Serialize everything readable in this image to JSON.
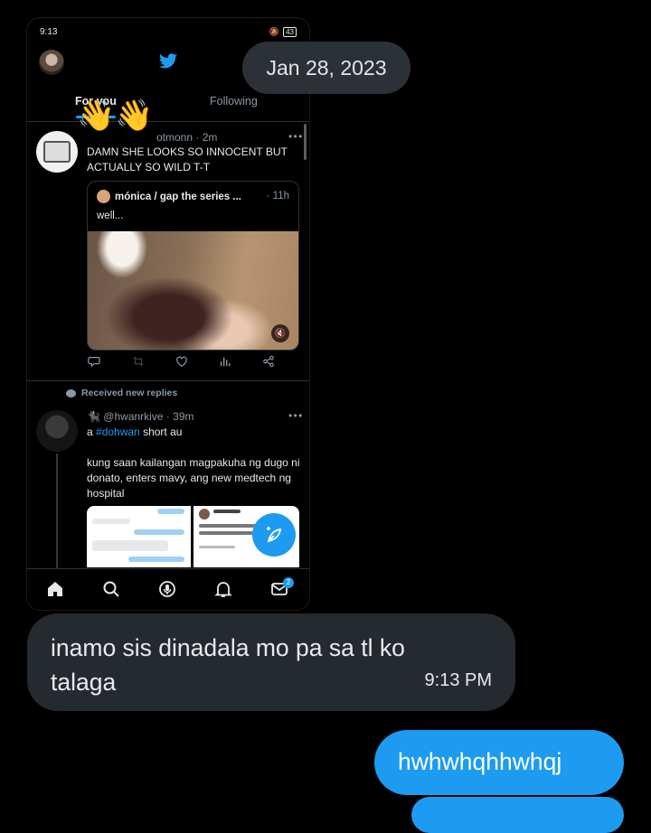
{
  "status_bar": {
    "time": "9:13",
    "signal": ".ıl",
    "battery": "43"
  },
  "tabs": [
    {
      "label": "For you"
    },
    {
      "label": "Following"
    }
  ],
  "wave_emoji": "👋👋",
  "tweet1": {
    "handle_meta": "otmonn · 2m",
    "more": "• • •",
    "text": "DAMN SHE LOOKS SO INNOCENT BUT ACTUALLY SO WILD T-T",
    "quote": {
      "name": "mónica / gap the series ...",
      "time": "· 11h",
      "text": "well..."
    }
  },
  "tweet_actions": [
    "reply-icon",
    "retweet-icon",
    "like-icon",
    "views-icon",
    "share-icon"
  ],
  "received_replies": "Received new replies",
  "tweet2": {
    "handle_meta": "@hwanrkive · 39m",
    "more": "• • •",
    "text_prefix": "a ",
    "hashtag": "#dohwan",
    "text_suffix": " short au",
    "body": "kung saan kailangan magpakuha ng dugo ni donato, enters mavy, ang new medtech ng hospital"
  },
  "nav": {
    "items": [
      "home-icon",
      "search-icon",
      "spaces-icon",
      "notifications-icon",
      "messages-icon"
    ],
    "messages_badge": "2"
  },
  "chat": {
    "date": "Jan 28, 2023",
    "incoming": {
      "text": "inamo sis dinadala mo pa sa tl ko talaga",
      "time": "9:13 PM"
    },
    "outgoing": {
      "text": "hwhwhqhhwhqj"
    }
  },
  "colors": {
    "accent": "#1d9bf0",
    "incoming_bubble": "#252a30",
    "date_pill": "#2c3137"
  }
}
